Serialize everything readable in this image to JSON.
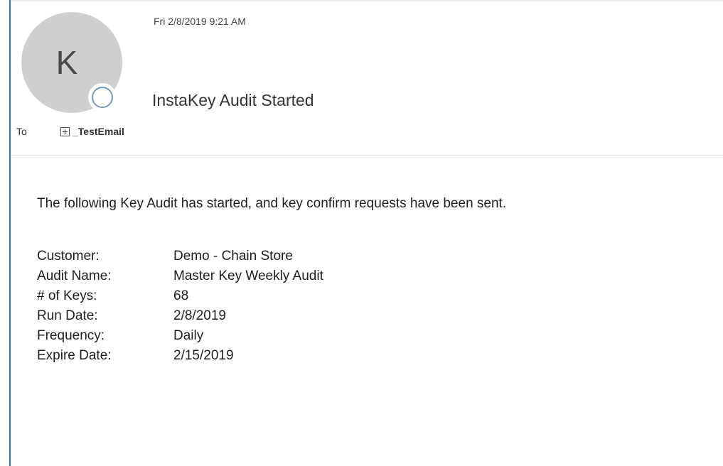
{
  "message": {
    "sender_initial": "K",
    "sent_datetime": "Fri 2/8/2019 9:21 AM",
    "subject": "InstaKey Audit Started",
    "to_label": "To",
    "recipient": "_TestEmail"
  },
  "body": {
    "intro": "The following Key Audit has started, and key confirm requests have been sent.",
    "details": [
      {
        "label": "Customer:",
        "value": "Demo - Chain Store"
      },
      {
        "label": "Audit Name:",
        "value": "Master Key Weekly Audit"
      },
      {
        "label": "# of Keys:",
        "value": "68"
      },
      {
        "label": "Run Date:",
        "value": "2/8/2019"
      },
      {
        "label": "Frequency:",
        "value": "Daily"
      },
      {
        "label": "Expire Date:",
        "value": "2/15/2019"
      }
    ]
  },
  "colors": {
    "accent": "#2b78c9",
    "avatar": "#cfcfcf",
    "presence_ring": "#7a9bb8"
  },
  "icons": {
    "expand": "plus-box-icon",
    "presence": "presence-ring-icon"
  }
}
